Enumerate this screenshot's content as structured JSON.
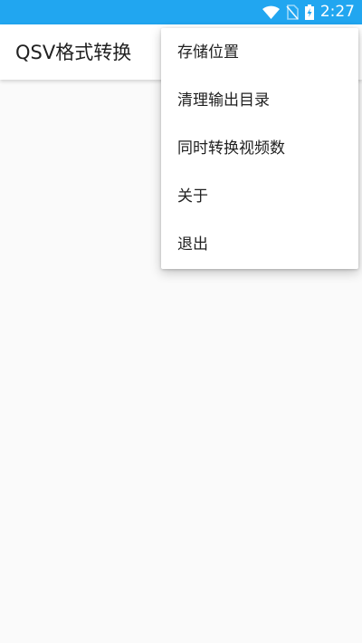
{
  "status_bar": {
    "time": "2:27",
    "color": "#21a6f0",
    "icons": [
      "wifi-icon",
      "no-sim-icon",
      "battery-charging-icon"
    ]
  },
  "app_bar": {
    "title": "QSV格式转换"
  },
  "overflow_menu": {
    "items": [
      {
        "label": "存储位置"
      },
      {
        "label": "清理输出目录"
      },
      {
        "label": "同时转换视频数"
      },
      {
        "label": "关于"
      },
      {
        "label": "退出"
      }
    ]
  }
}
